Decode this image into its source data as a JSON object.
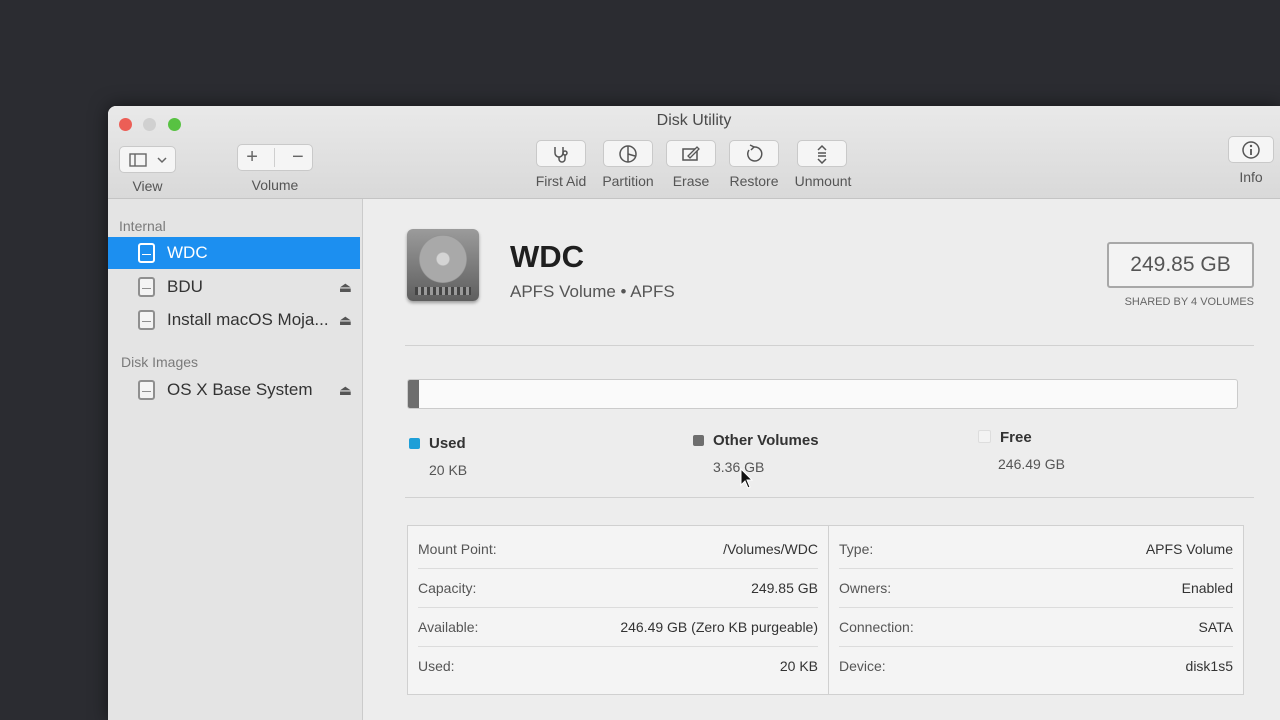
{
  "window": {
    "title": "Disk Utility"
  },
  "toolbar": {
    "view_label": "View",
    "volume_label": "Volume",
    "add_symbol": "+",
    "remove_symbol": "−",
    "first_aid_label": "First Aid",
    "partition_label": "Partition",
    "erase_label": "Erase",
    "restore_label": "Restore",
    "unmount_label": "Unmount",
    "info_label": "Info"
  },
  "sidebar": {
    "internal_header": "Internal",
    "internal_items": [
      {
        "label": "WDC",
        "selected": true,
        "ejectable": false
      },
      {
        "label": "BDU",
        "selected": false,
        "ejectable": true
      },
      {
        "label": "Install macOS Moja...",
        "selected": false,
        "ejectable": true
      }
    ],
    "images_header": "Disk Images",
    "image_items": [
      {
        "label": "OS X Base System",
        "selected": false,
        "ejectable": true
      }
    ],
    "eject_symbol": "⏏"
  },
  "volume": {
    "name": "WDC",
    "subtitle": "APFS Volume • APFS",
    "capacity": "249.85 GB",
    "capacity_note": "SHARED BY 4 VOLUMES"
  },
  "usage": {
    "used": {
      "label": "Used",
      "value": "20 KB",
      "color": "#1e9fd8",
      "fraction": 0.0
    },
    "other": {
      "label": "Other Volumes",
      "value": "3.36 GB",
      "color": "#6e6e6e",
      "fraction": 0.013
    },
    "free": {
      "label": "Free",
      "value": "246.49 GB",
      "color": "#f3f3f3",
      "fraction": 0.987
    }
  },
  "info": {
    "left": [
      {
        "key": "Mount Point:",
        "value": "/Volumes/WDC"
      },
      {
        "key": "Capacity:",
        "value": "249.85 GB"
      },
      {
        "key": "Available:",
        "value": "246.49 GB (Zero KB purgeable)"
      },
      {
        "key": "Used:",
        "value": "20 KB"
      }
    ],
    "right": [
      {
        "key": "Type:",
        "value": "APFS Volume"
      },
      {
        "key": "Owners:",
        "value": "Enabled"
      },
      {
        "key": "Connection:",
        "value": "SATA"
      },
      {
        "key": "Device:",
        "value": "disk1s5"
      }
    ]
  }
}
